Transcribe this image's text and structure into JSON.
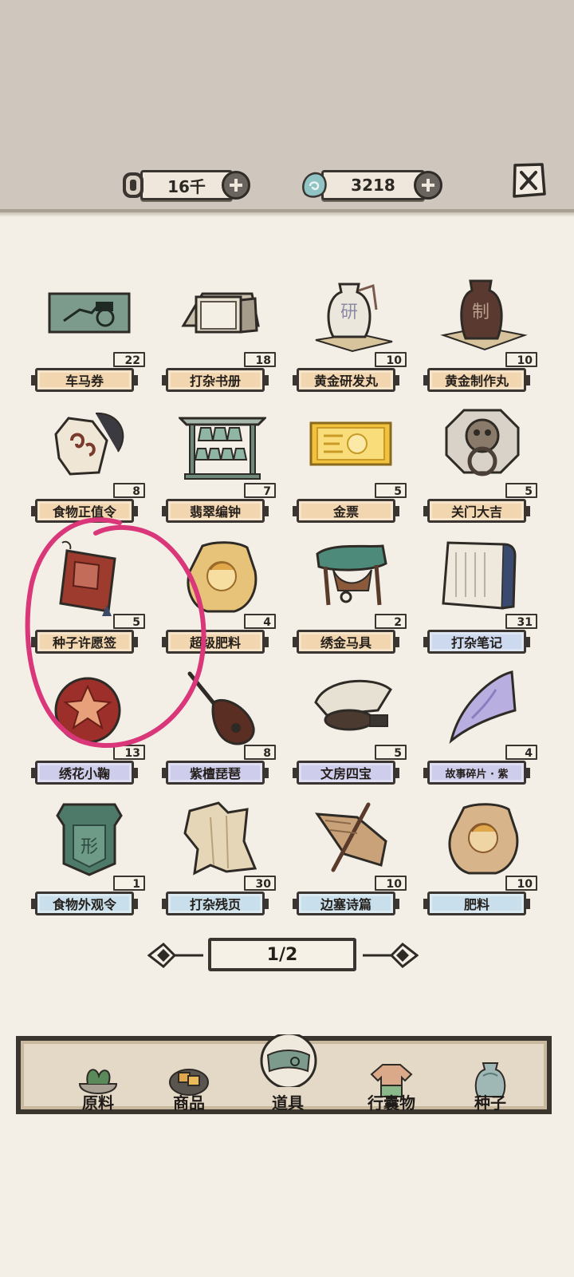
{
  "currency": {
    "coins": "16千",
    "jade": "3218"
  },
  "items": [
    {
      "name": "车马券",
      "count": "22",
      "label_color": "#f1d6b0"
    },
    {
      "name": "打杂书册",
      "count": "18",
      "label_color": "#f1d6b0"
    },
    {
      "name": "黄金研发丸",
      "count": "10",
      "label_color": "#f1d6b0"
    },
    {
      "name": "黄金制作丸",
      "count": "10",
      "label_color": "#f1d6b0"
    },
    {
      "name": "食物正值令",
      "count": "8",
      "label_color": "#f1d6b0"
    },
    {
      "name": "翡翠编钟",
      "count": "7",
      "label_color": "#f1d6b0"
    },
    {
      "name": "金票",
      "count": "5",
      "label_color": "#f1d6b0"
    },
    {
      "name": "关门大吉",
      "count": "5",
      "label_color": "#f1d6b0"
    },
    {
      "name": "种子许愿签",
      "count": "5",
      "label_color": "#f1d6b0"
    },
    {
      "name": "超级肥料",
      "count": "4",
      "label_color": "#f1d6b0"
    },
    {
      "name": "绣金马具",
      "count": "2",
      "label_color": "#f1d6b0"
    },
    {
      "name": "打杂笔记",
      "count": "31",
      "label_color": "#ccd9ef"
    },
    {
      "name": "绣花小鞠",
      "count": "13",
      "label_color": "#cfcdec"
    },
    {
      "name": "紫檀琵琶",
      "count": "8",
      "label_color": "#cfcdec"
    },
    {
      "name": "文房四宝",
      "count": "5",
      "label_color": "#cfcdec"
    },
    {
      "name": "故事碎片 · 紫",
      "count": "4",
      "label_color": "#cfcdec"
    },
    {
      "name": "食物外观令",
      "count": "1",
      "label_color": "#c9e0ec"
    },
    {
      "name": "打杂残页",
      "count": "30",
      "label_color": "#c9e0ec"
    },
    {
      "name": "边塞诗篇",
      "count": "10",
      "label_color": "#c9e0ec"
    },
    {
      "name": "肥料",
      "count": "10",
      "label_color": "#c9e0ec"
    }
  ],
  "pager": {
    "text": "1/2"
  },
  "tabs": [
    {
      "label": "原料"
    },
    {
      "label": "商品"
    },
    {
      "label": "道具"
    },
    {
      "label": "行囊物"
    },
    {
      "label": "种子"
    }
  ],
  "active_tab": "道具",
  "colors": {
    "annotation_circle": "#d9377a",
    "background": "#f3efe6",
    "topbar": "#cfc7be"
  }
}
